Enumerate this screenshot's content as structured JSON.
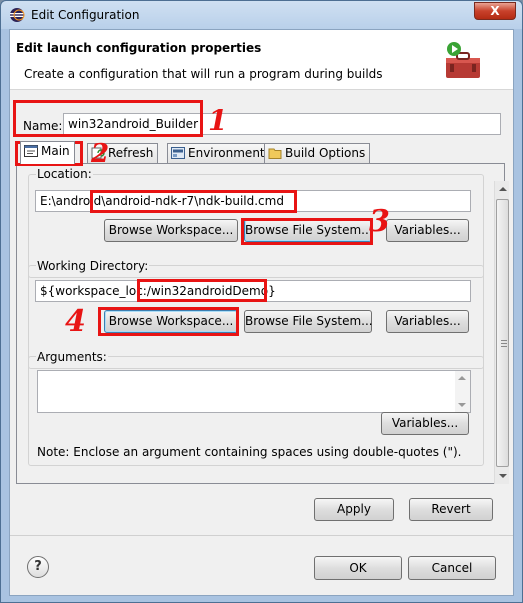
{
  "window": {
    "title": "Edit Configuration",
    "close_symbol": "X"
  },
  "header": {
    "title": "Edit launch configuration properties",
    "description": "Create a configuration that will run a program during builds",
    "icon": "toolbox-icon"
  },
  "name_field": {
    "label": "Name:",
    "value": "win32android_Builder"
  },
  "tabs": [
    {
      "label": "Main",
      "icon": "main-tab-icon",
      "active": true
    },
    {
      "label": "Refresh",
      "icon": "refresh-icon",
      "active": false
    },
    {
      "label": "Environment",
      "icon": "environment-icon",
      "active": false
    },
    {
      "label": "Build Options",
      "icon": "build-options-icon",
      "active": false
    }
  ],
  "location": {
    "label": "Location:",
    "value": "E:\\android\\android-ndk-r7\\ndk-build.cmd",
    "buttons": [
      "Browse Workspace...",
      "Browse File System...",
      "Variables..."
    ]
  },
  "working_directory": {
    "label": "Working Directory:",
    "value": "${workspace_loc:/win32androidDemo}",
    "buttons": [
      "Browse Workspace...",
      "Browse File System...",
      "Variables..."
    ]
  },
  "arguments": {
    "label": "Arguments:",
    "value": "",
    "variables_button": "Variables...",
    "note": "Note: Enclose an argument containing spaces using double-quotes (\")."
  },
  "actions": {
    "apply": "Apply",
    "revert": "Revert",
    "ok": "OK",
    "cancel": "Cancel",
    "help_symbol": "?"
  },
  "annotations": {
    "color": "#e81414",
    "marks": [
      "1",
      "2",
      "3",
      "4"
    ]
  }
}
